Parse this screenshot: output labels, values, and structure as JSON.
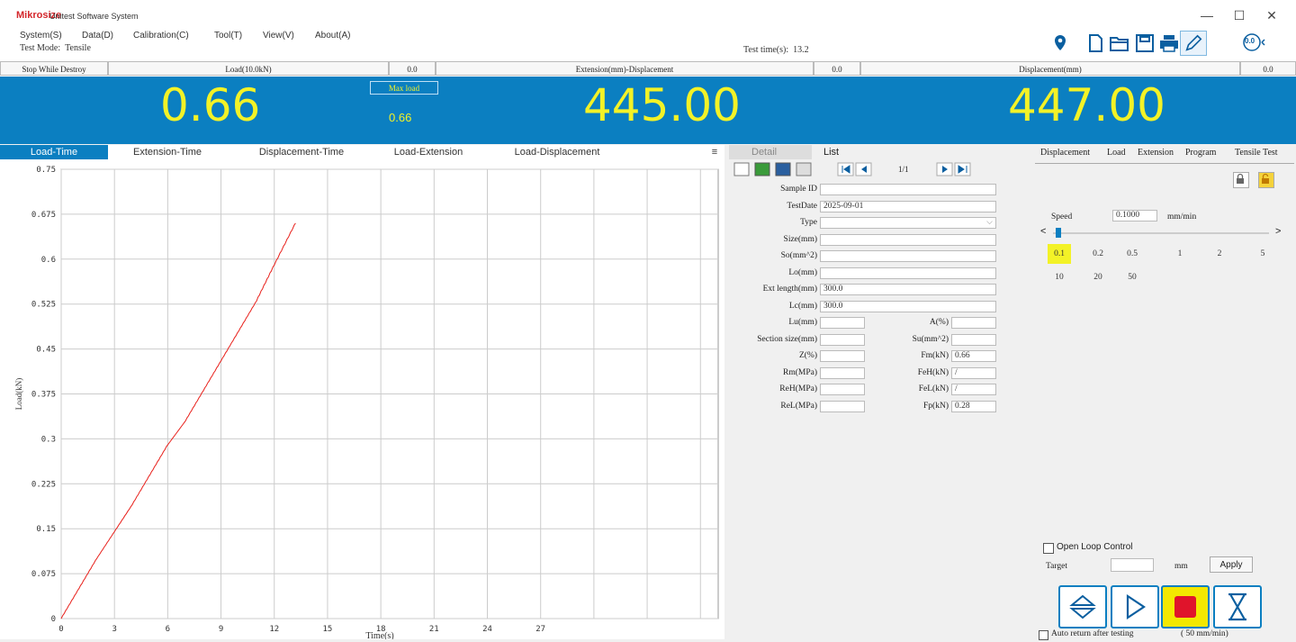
{
  "app": {
    "logo": "Mikrosize",
    "title": "Unitest Software System"
  },
  "window": {
    "minimize": "—",
    "maximize": "☐",
    "close": "✕"
  },
  "menu": [
    "System(S)",
    "Data(D)",
    "Calibration(C)",
    "Tool(T)",
    "View(V)",
    "About(A)"
  ],
  "test_mode": {
    "label": "Test Mode:",
    "value": "Tensile"
  },
  "test_time": {
    "label": "Test time(s):",
    "value": "13.2"
  },
  "toolbar_icons": [
    "location-icon",
    "new-file-icon",
    "open-folder-icon",
    "save-icon",
    "print-icon",
    "edit-icon",
    "zero-icon"
  ],
  "zero_label": "0.0",
  "header": {
    "stop": "Stop While Destroy",
    "load_label": "Load(10.0kN)",
    "load_val": "0.0",
    "ext_label": "Extension(mm)-Displacement",
    "ext_val": "0.0",
    "disp_label": "Displacement(mm)",
    "disp_val": "0.0"
  },
  "readouts": {
    "load": "0.66",
    "max_load_label": "Max load",
    "max_load": "0.66",
    "extension": "445.00",
    "displacement": "447.00"
  },
  "chart_tabs": [
    "Load-Time",
    "Extension-Time",
    "Displacement-Time",
    "Load-Extension",
    "Load-Displacement"
  ],
  "chart_menu": "≡",
  "chart_data": {
    "type": "line",
    "xlabel": "Time(s)",
    "ylabel": "Load(kN)",
    "xlim": [
      0,
      37
    ],
    "ylim": [
      0,
      0.75
    ],
    "x_ticks": [
      "0",
      "3",
      "6",
      "9",
      "12",
      "15",
      "18",
      "21",
      "24",
      "27"
    ],
    "y_ticks": [
      "0",
      "0.075",
      "0.15",
      "0.225",
      "0.3",
      "0.375",
      "0.45",
      "0.525",
      "0.6",
      "0.675",
      "0.75"
    ],
    "series": [
      {
        "color": "#e8201b",
        "x": [
          0,
          1,
          2,
          3,
          4,
          5,
          6,
          7,
          8,
          9,
          10,
          11,
          12,
          13.2
        ],
        "y": [
          0,
          0.05,
          0.1,
          0.145,
          0.19,
          0.24,
          0.29,
          0.33,
          0.38,
          0.43,
          0.48,
          0.53,
          0.59,
          0.66
        ]
      }
    ],
    "grid": true
  },
  "detail": {
    "tabs": [
      "Detail",
      "List"
    ],
    "page": "1/1",
    "fields": [
      {
        "label": "Sample ID",
        "value": ""
      },
      {
        "label": "TestDate",
        "value": "2025-09-01"
      },
      {
        "label": "Type",
        "value": ""
      },
      {
        "label": "Size(mm)",
        "value": ""
      },
      {
        "label": "So(mm^2)",
        "value": ""
      },
      {
        "label": "Lo(mm)",
        "value": ""
      },
      {
        "label": "Ext length(mm)",
        "value": "300.0"
      },
      {
        "label": "Lc(mm)",
        "value": "300.0"
      }
    ],
    "left_fields": [
      {
        "label": "Lu(mm)",
        "value": ""
      },
      {
        "label": "Section size(mm)",
        "value": ""
      },
      {
        "label": "Z(%)",
        "value": ""
      },
      {
        "label": "Rm(MPa)",
        "value": ""
      },
      {
        "label": "ReH(MPa)",
        "value": ""
      },
      {
        "label": "ReL(MPa)",
        "value": ""
      }
    ],
    "right_fields": [
      {
        "label": "A(%)",
        "value": ""
      },
      {
        "label": "Su(mm^2)",
        "value": ""
      },
      {
        "label": "Fm(kN)",
        "value": "0.66"
      },
      {
        "label": "FeH(kN)",
        "value": "/"
      },
      {
        "label": "FeL(kN)",
        "value": "/"
      },
      {
        "label": "Fp(kN)",
        "value": "0.28"
      }
    ]
  },
  "right": {
    "tabs": [
      "Displacement",
      "Load",
      "Extension",
      "Program",
      "Tensile Test"
    ],
    "speed_label": "Speed",
    "speed_value": "0.1000",
    "speed_unit": "mm/min",
    "slider_left": "<",
    "slider_right": ">",
    "speeds_row1": [
      "0.1",
      "0.2",
      "0.5",
      "1",
      "2",
      "5"
    ],
    "speeds_row2": [
      "10",
      "20",
      "50"
    ],
    "open_loop": "Open Loop Control",
    "target_label": "Target",
    "target_unit": "mm",
    "apply": "Apply",
    "auto_return": "Auto return after testing",
    "return_speed": "( 50    mm/min)"
  }
}
